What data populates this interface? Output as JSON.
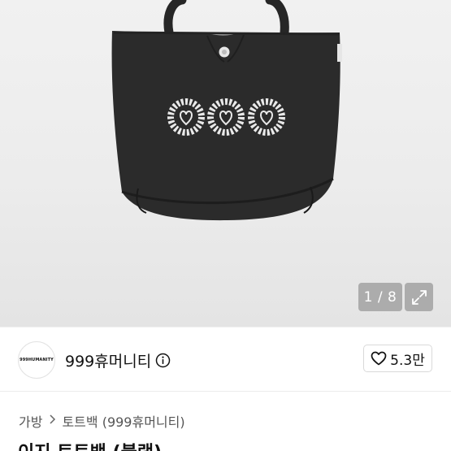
{
  "gallery": {
    "counter": "1 / 8",
    "expand_icon": "expand-icon",
    "bag_color": "#2b2b2b"
  },
  "shop": {
    "logo_text": "999HUMANITY",
    "name": "999휴머니티",
    "info_icon": "info-icon",
    "like_icon": "heart-icon",
    "likes": "5.3만"
  },
  "breadcrumb": {
    "category": "가방",
    "subcategory": "토트백 (999휴머니티)",
    "separator_icon": "chevron-right-icon"
  },
  "product": {
    "title": "이지 토트백 (블랙)"
  }
}
